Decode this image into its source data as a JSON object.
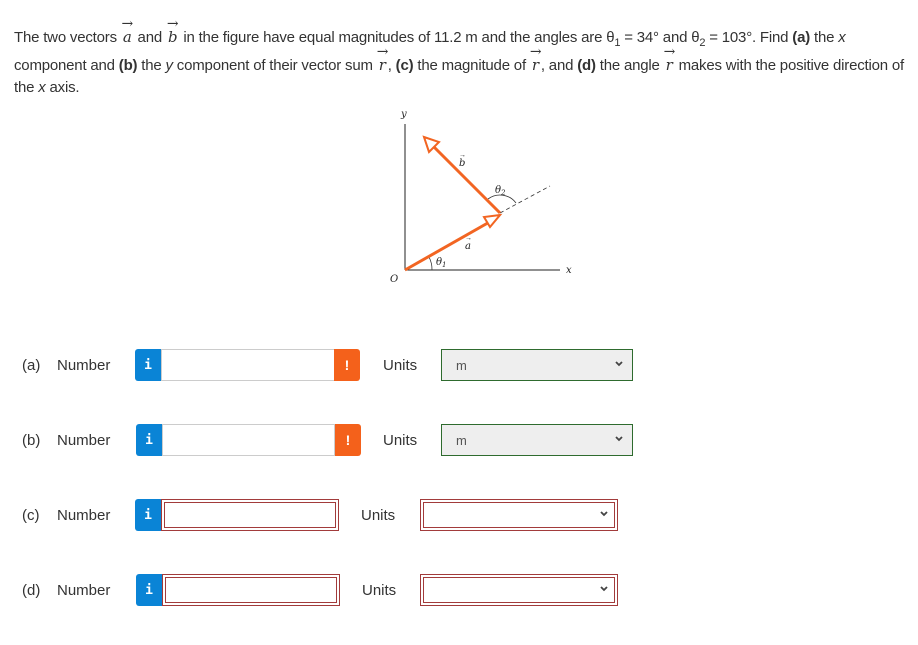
{
  "question": {
    "t1": "The two vectors ",
    "vec_a": "a",
    "t2": " and ",
    "vec_b": "b",
    "t3": " in the figure have equal magnitudes of 11.2 m and the angles are θ",
    "sub1": "1",
    "t4": " = 34° and θ",
    "sub2": "2",
    "t5": " = 103°. Find ",
    "pa": "(a)",
    "t6": " the ",
    "x1": "x",
    "t7": " component and ",
    "pb": "(b)",
    "t8": " the ",
    "y1": "y",
    "t9": " component of their vector sum ",
    "vec_r1": "r",
    "t10": ", ",
    "pc": "(c)",
    "t11": " the magnitude of ",
    "vec_r2": "r",
    "t12": ", and ",
    "pd": "(d)",
    "t13": " the angle ",
    "vec_r3": "r",
    "t14": " makes with the positive direction of the ",
    "x2": "x",
    "t15": " axis."
  },
  "figure": {
    "y_label": "y",
    "x_label": "x",
    "origin_label": "O",
    "a_label": "a",
    "b_label": "b",
    "theta1_label": "θ",
    "theta1_sub": "1",
    "theta2_label": "θ",
    "theta2_sub": "2",
    "vector_color": "#f26522"
  },
  "answers": [
    {
      "part": "(a)",
      "number_label": "Number",
      "value": "",
      "info_icon": "i",
      "warn_icon": "!",
      "units_label": "Units",
      "units_value": "m",
      "state": "warning"
    },
    {
      "part": "(b)",
      "number_label": "Number",
      "value": "",
      "info_icon": "i",
      "warn_icon": "!",
      "units_label": "Units",
      "units_value": "m",
      "state": "warning"
    },
    {
      "part": "(c)",
      "number_label": "Number",
      "value": "",
      "info_icon": "i",
      "units_label": "Units",
      "units_value": "",
      "state": "error"
    },
    {
      "part": "(d)",
      "number_label": "Number",
      "value": "",
      "info_icon": "i",
      "units_label": "Units",
      "units_value": "",
      "state": "error"
    }
  ],
  "colors": {
    "info_blue": "#0a84d6",
    "warn_orange": "#f4611b",
    "error_border": "#a23b3b",
    "ok_border": "#2e6b2e"
  }
}
